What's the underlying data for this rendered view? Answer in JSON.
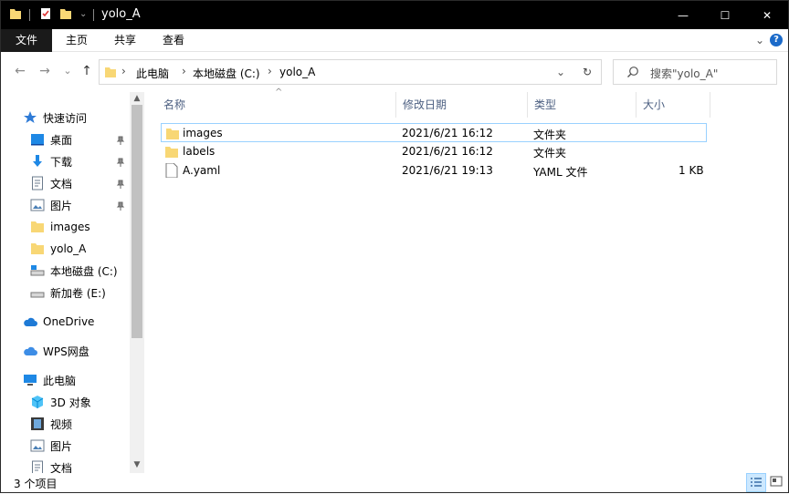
{
  "window": {
    "title": "yolo_A"
  },
  "window_controls": {
    "minimize": "—",
    "maximize": "☐",
    "close": "✕"
  },
  "ribbon": {
    "tabs": [
      {
        "label": "文件"
      },
      {
        "label": "主页"
      },
      {
        "label": "共享"
      },
      {
        "label": "查看"
      }
    ]
  },
  "navigation": {
    "back": "←",
    "forward": "→",
    "recent": "⌄",
    "up": "↑",
    "breadcrumb": [
      "此电脑",
      "本地磁盘 (C:)",
      "yolo_A"
    ],
    "breadcrumb_sep": "›",
    "refresh": "↻",
    "dropdown": "⌄"
  },
  "search": {
    "placeholder": "搜索\"yolo_A\""
  },
  "sidebar": {
    "items": [
      {
        "label": "快速访问",
        "icon": "star-icon",
        "pinned": false
      },
      {
        "label": "桌面",
        "icon": "desktop-icon",
        "pinned": true
      },
      {
        "label": "下载",
        "icon": "download-icon",
        "pinned": true
      },
      {
        "label": "文档",
        "icon": "document-icon",
        "pinned": true
      },
      {
        "label": "图片",
        "icon": "pictures-icon",
        "pinned": true
      },
      {
        "label": "images",
        "icon": "folder-icon",
        "pinned": false
      },
      {
        "label": "yolo_A",
        "icon": "folder-icon",
        "pinned": false
      },
      {
        "label": "本地磁盘 (C:)",
        "icon": "drive-icon",
        "pinned": false
      },
      {
        "label": "新加卷 (E:)",
        "icon": "drive-icon",
        "pinned": false
      },
      {
        "label": "OneDrive",
        "icon": "cloud-icon",
        "pinned": false
      },
      {
        "label": "WPS网盘",
        "icon": "wps-cloud-icon",
        "pinned": false
      },
      {
        "label": "此电脑",
        "icon": "computer-icon",
        "pinned": false
      },
      {
        "label": "3D 对象",
        "icon": "3d-objects-icon",
        "pinned": false
      },
      {
        "label": "视频",
        "icon": "video-icon",
        "pinned": false
      },
      {
        "label": "图片",
        "icon": "pictures-icon",
        "pinned": false
      },
      {
        "label": "文档",
        "icon": "document-icon",
        "pinned": false
      }
    ]
  },
  "columns": {
    "name": "名称",
    "modified": "修改日期",
    "type": "类型",
    "size": "大小"
  },
  "files": [
    {
      "name": "images",
      "modified": "2021/6/21 16:12",
      "type": "文件夹",
      "size": "",
      "icon": "folder-icon"
    },
    {
      "name": "labels",
      "modified": "2021/6/21 16:12",
      "type": "文件夹",
      "size": "",
      "icon": "folder-icon"
    },
    {
      "name": "A.yaml",
      "modified": "2021/6/21 19:13",
      "type": "YAML 文件",
      "size": "1 KB",
      "icon": "file-icon"
    }
  ],
  "status": {
    "item_count": "3 个项目"
  },
  "colors": {
    "accent": "#1b6ac9",
    "folder": "#f8d775",
    "selection_border": "#99d1ff",
    "titlebar": "#000000"
  }
}
